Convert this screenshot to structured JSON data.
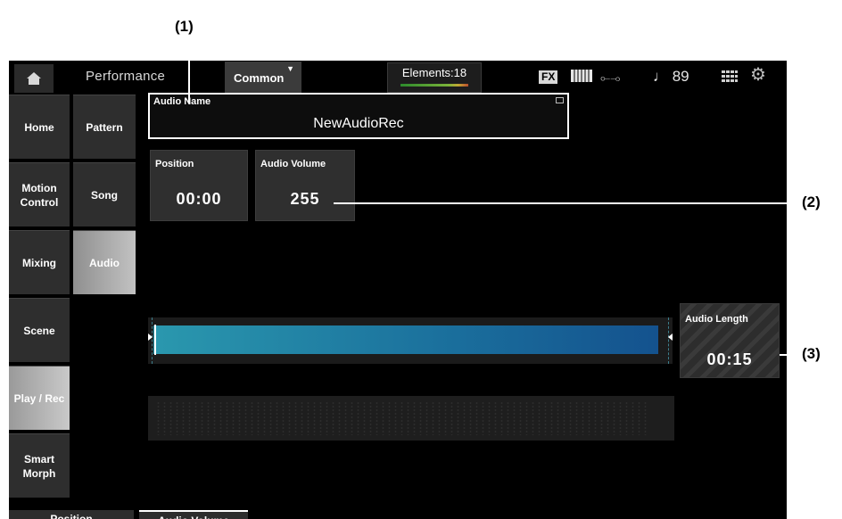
{
  "callouts": {
    "c1": "(1)",
    "c2": "(2)",
    "c3": "(3)"
  },
  "topbar": {
    "title": "Performance",
    "common_label": "Common",
    "elements_label": "Elements:18",
    "fx_label": "FX",
    "tempo": "♩ 89"
  },
  "nav_primary": [
    {
      "label": "Home"
    },
    {
      "label": "Motion Control"
    },
    {
      "label": "Mixing"
    },
    {
      "label": "Scene"
    },
    {
      "label": "Play / Rec"
    },
    {
      "label": "Smart Morph"
    }
  ],
  "nav_secondary": [
    {
      "label": "Pattern"
    },
    {
      "label": "Song"
    },
    {
      "label": "Audio"
    }
  ],
  "audio_name": {
    "label": "Audio Name",
    "value": "NewAudioRec"
  },
  "position": {
    "label": "Position",
    "value": "00:00"
  },
  "audio_volume": {
    "label": "Audio Volume",
    "value": "255"
  },
  "audio_length": {
    "label": "Audio Length",
    "value": "00:15"
  },
  "bottom_tabs": [
    {
      "label": "Position"
    },
    {
      "label": "Audio Volume"
    }
  ],
  "colors": {
    "waveform": "#1a6e9c",
    "active_tab": "#bcbcbc"
  }
}
